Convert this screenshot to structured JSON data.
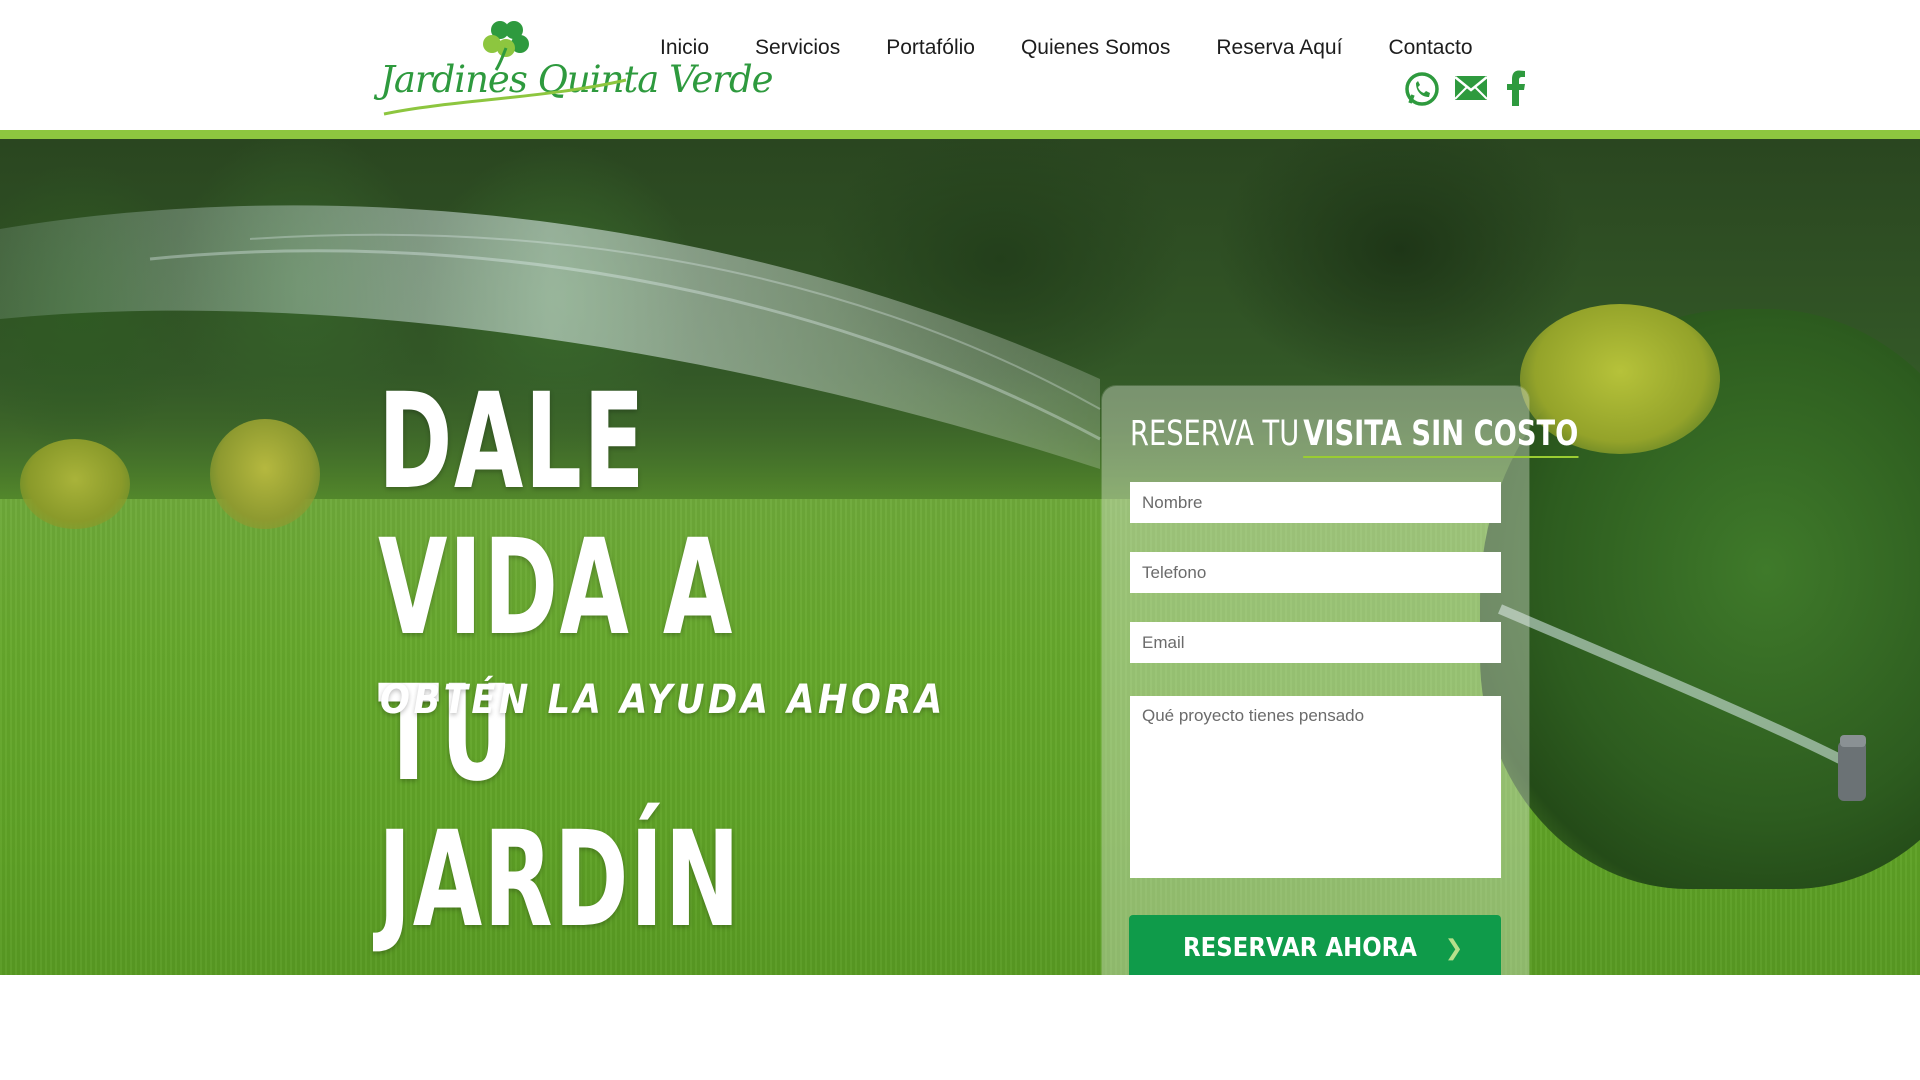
{
  "brand": {
    "name": "Jardines Quinta Verde",
    "colors": {
      "green": "#2e9a3e",
      "accent_bar": "#8dc63f",
      "button": "#0f9b4a"
    }
  },
  "nav": {
    "items": [
      {
        "label": "Inicio"
      },
      {
        "label": "Servicios"
      },
      {
        "label": "Portafólio"
      },
      {
        "label": "Quienes Somos"
      },
      {
        "label": "Reserva Aquí"
      },
      {
        "label": "Contacto"
      }
    ]
  },
  "social": {
    "icons": [
      "whatsapp-icon",
      "email-icon",
      "facebook-icon"
    ]
  },
  "hero": {
    "title_line1": "DALE VIDA A",
    "title_line2": "TU JARDÍN",
    "subtitle": "OBTÉN LA AYUDA AHORA"
  },
  "form": {
    "title_light": "RESERVA TU",
    "title_bold": "VISITA SIN COSTO",
    "name_placeholder": "Nombre",
    "phone_placeholder": "Telefono",
    "email_placeholder": "Email",
    "project_placeholder": "Qué proyecto tienes pensado",
    "submit_label": "RESERVAR AHORA"
  }
}
